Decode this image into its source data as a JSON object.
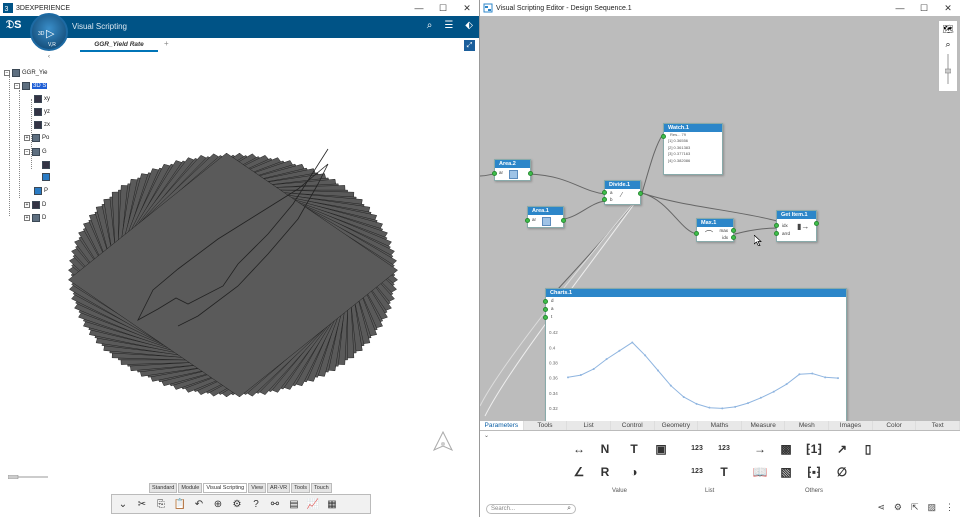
{
  "left_window": {
    "title": "3DEXPERIENCE",
    "app_name": "Visual Scripting",
    "compass": {
      "label_3d": "3D",
      "label_vr": "V,R"
    },
    "tab": "GGR_Yield Rate",
    "tree": [
      {
        "label": "GGR_Yie",
        "level": 0
      },
      {
        "label": "3D S",
        "level": 1,
        "selected": true
      },
      {
        "label": "xy",
        "level": 2
      },
      {
        "label": "yz",
        "level": 2
      },
      {
        "label": "zx",
        "level": 2
      },
      {
        "label": "Po",
        "level": 2
      },
      {
        "label": "G",
        "level": 2
      },
      {
        "label": "P",
        "level": 2
      },
      {
        "label": "D",
        "level": 1
      },
      {
        "label": "D",
        "level": 1
      }
    ],
    "bottom_tabs": [
      "Standard",
      "Module",
      "Visual Scripting",
      "View",
      "AR-VR",
      "Tools",
      "Touch"
    ],
    "active_bottom_tab": "Visual Scripting"
  },
  "right_window": {
    "title": "Visual Scripting Editor - Design Sequence.1",
    "nodes": {
      "watch": {
        "title": "Watch.1",
        "subtitle": "Res... 79",
        "rows": [
          "[1] 0.36556",
          "[2] 0.361383",
          "[3] 0.377163",
          "[4] 0.382086"
        ]
      },
      "area2": {
        "title": "Area.2",
        "port": "ar"
      },
      "area1": {
        "title": "Area.1",
        "port": "ar"
      },
      "divide": {
        "title": "Divide.1",
        "ports": [
          "a",
          "b"
        ]
      },
      "max": {
        "title": "Max.1",
        "ports": [
          "max",
          "idx"
        ]
      },
      "getitem": {
        "title": "Get Item.1",
        "ports": [
          "idx",
          "arrd"
        ]
      },
      "charts": {
        "title": "Charts.1",
        "ports": [
          "d",
          "a",
          "t"
        ]
      }
    },
    "chart_data": {
      "type": "line",
      "ylim": [
        0.31,
        0.43
      ],
      "yticks": [
        "0.42",
        "0.4",
        "0.38",
        "0.36",
        "0.34",
        "0.32"
      ],
      "values": [
        0.361,
        0.364,
        0.372,
        0.385,
        0.396,
        0.407,
        0.39,
        0.37,
        0.35,
        0.335,
        0.326,
        0.321,
        0.32,
        0.322,
        0.327,
        0.334,
        0.342,
        0.352,
        0.365,
        0.366,
        0.361,
        0.36
      ],
      "color": "#8fb5e0"
    },
    "palette_tabs": [
      "Parameters",
      "Tools",
      "List",
      "Control",
      "Geometry",
      "Maths",
      "Measure",
      "Mesh",
      "Images",
      "Color",
      "Text"
    ],
    "active_palette_tab": "Parameters",
    "groups": [
      "Value",
      "List",
      "Others"
    ],
    "search_placeholder": "Search..."
  },
  "winctl": {
    "min": "—",
    "max": "☐",
    "close": "✕"
  }
}
